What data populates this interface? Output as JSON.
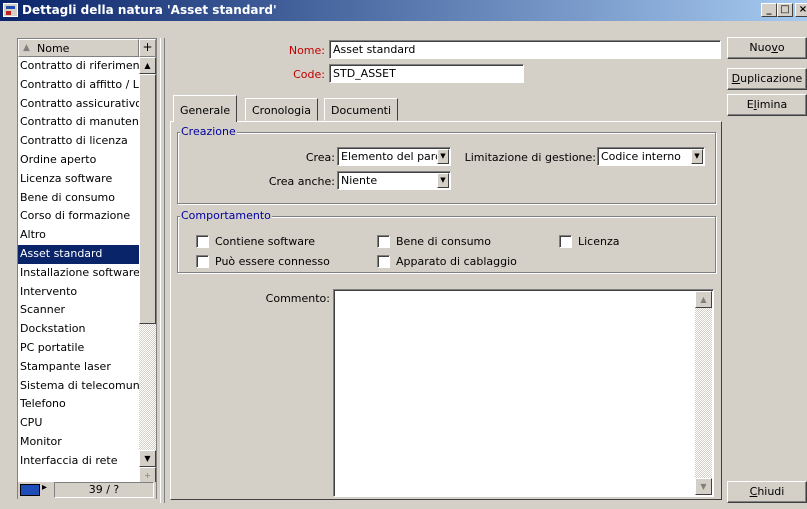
{
  "window": {
    "title": "Dettagli della natura 'Asset standard'",
    "min_glyph": "_",
    "max_glyph": "□",
    "close_glyph": "×"
  },
  "list": {
    "header": "Nome",
    "add_glyph": "+",
    "items": [
      "Contratto di riferiment",
      "Contratto di affitto / L",
      "Contratto assicurativo",
      "Contratto di manuten:",
      "Contratto di licenza",
      "Ordine aperto",
      "Licenza software",
      "Bene di consumo",
      "Corso di formazione",
      "Altro",
      "Asset standard",
      "Installazione software",
      "Intervento",
      "Scanner",
      "Dockstation",
      "PC portatile",
      "Stampante laser",
      "Sistema di telecomun",
      "Telefono",
      "CPU",
      "Monitor",
      "Interfaccia di rete"
    ],
    "selected_index": 10,
    "counter": "39 / ?"
  },
  "form": {
    "name_label": "Nome:",
    "name_value": "Asset standard",
    "code_label": "Code:",
    "code_value": "STD_ASSET"
  },
  "tabs": [
    {
      "label": "Generale",
      "active": true
    },
    {
      "label": "Cronologia",
      "active": false
    },
    {
      "label": "Documenti",
      "active": false
    }
  ],
  "creation": {
    "legend": "Creazione",
    "crea_label": "Crea:",
    "crea_value": "Elemento del parc",
    "limit_label": "Limitazione di gestione:",
    "limit_value": "Codice interno",
    "crea_anche_label": "Crea anche:",
    "crea_anche_value": "Niente"
  },
  "behaviour": {
    "legend": "Comportamento",
    "checkboxes": [
      {
        "label": "Contiene software",
        "checked": false
      },
      {
        "label": "Bene di consumo",
        "checked": false
      },
      {
        "label": "Licenza",
        "checked": false
      },
      {
        "label": "Può essere connesso",
        "checked": false
      },
      {
        "label": "Apparato di cablaggio",
        "checked": false
      }
    ]
  },
  "comment": {
    "label": "Commento:",
    "value": ""
  },
  "buttons": {
    "new": {
      "pre": "Nuo",
      "u": "v",
      "post": "o"
    },
    "duplicate": {
      "pre": "",
      "u": "D",
      "post": "uplicazione"
    },
    "delete": {
      "pre": "E",
      "u": "l",
      "post": "imina"
    },
    "close": {
      "pre": "",
      "u": "C",
      "post": "hiudi"
    }
  }
}
